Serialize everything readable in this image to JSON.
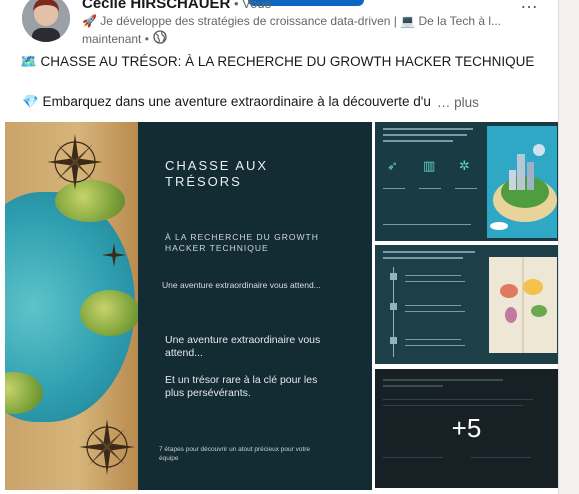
{
  "post": {
    "author_name": "Cécile HIRSCHAUER",
    "author_you": " • Vous",
    "headline": "🚀 Je développe des stratégies de croissance data-driven | 💻 De la Tech à l...",
    "timestamp": "maintenant •",
    "visibility_icon": "globe-icon",
    "more_icon": "…",
    "line1": "🗺️ CHASSE AU TRÉSOR: À LA RECHERCHE DU GROWTH HACKER TECHNIQUE",
    "line2": "💎 Embarquez dans une aventure extraordinaire à la découverte d'u",
    "see_more": "… plus"
  },
  "slide": {
    "title": "CHASSE AUX\nTRÉSORS",
    "subtitle": "À LA RECHERCHE DU GROWTH\nHACKER TECHNIQUE",
    "line": "Une aventure extraordinaire vous attend...",
    "para1": "Une aventure extraordinaire vous\nattend...",
    "para2": "Et un trésor rare à la clé pour les\nplus persévérants.",
    "footer": "7 étapes pour découvrir un atout précieux pour votre\néquipe"
  },
  "gallery": {
    "more_count": "+5"
  },
  "colors": {
    "accent": "#0a66c2",
    "slide_bg": "#132b33"
  }
}
